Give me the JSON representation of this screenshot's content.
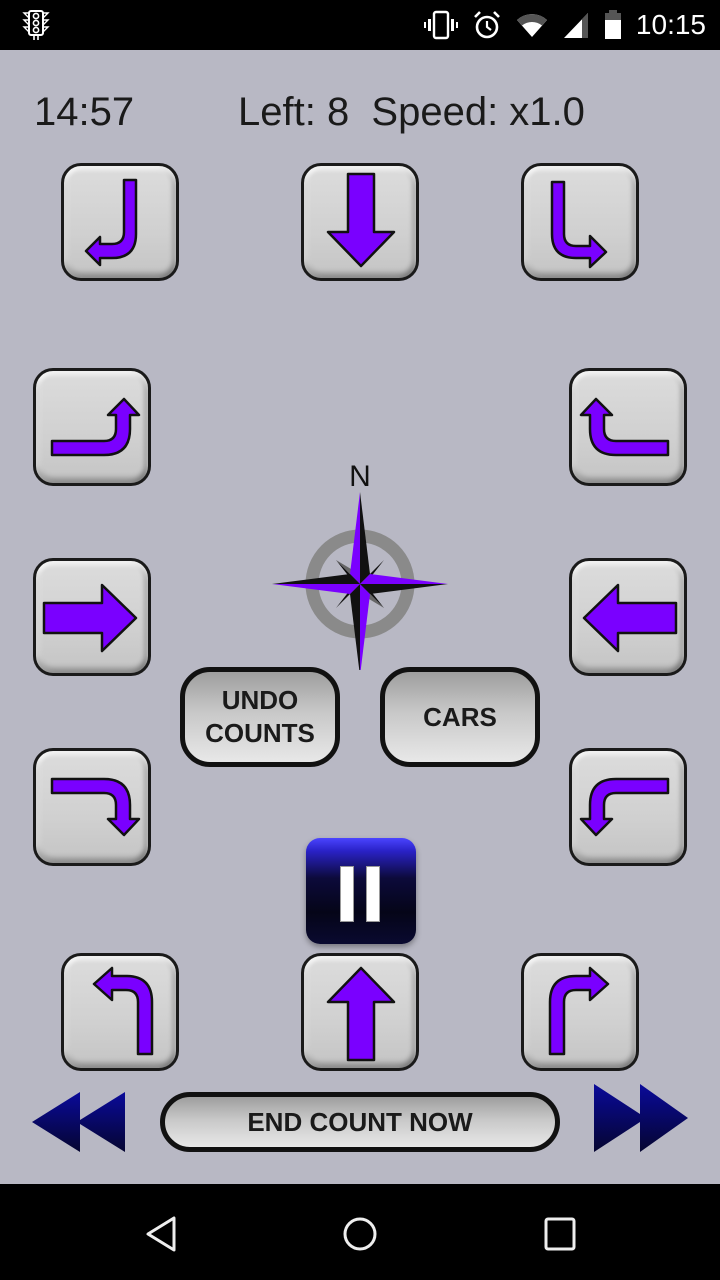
{
  "status_bar": {
    "app_icon": "traffic-light-icon",
    "icons": [
      "vibrate-icon",
      "alarm-icon",
      "wifi-icon",
      "signal-icon",
      "battery-icon"
    ],
    "time": "10:15"
  },
  "header": {
    "timer": "14:57",
    "left_label": "Left: 8  Speed: x1.0"
  },
  "movement_buttons": [
    {
      "id": "north-u-turn",
      "icon": "u-turn-left-down-icon"
    },
    {
      "id": "south-through",
      "icon": "arrow-down-icon"
    },
    {
      "id": "north-left",
      "icon": "turn-down-right-icon"
    },
    {
      "id": "west-u",
      "icon": "turn-right-up-icon"
    },
    {
      "id": "east-u",
      "icon": "turn-left-up-icon"
    },
    {
      "id": "west-through",
      "icon": "arrow-right-icon"
    },
    {
      "id": "east-through",
      "icon": "arrow-left-icon"
    },
    {
      "id": "west-right",
      "icon": "turn-right-down-icon"
    },
    {
      "id": "east-left",
      "icon": "turn-left-down-icon"
    },
    {
      "id": "south-left",
      "icon": "turn-up-left-icon"
    },
    {
      "id": "north-through",
      "icon": "arrow-up-icon"
    },
    {
      "id": "south-right",
      "icon": "turn-up-right-icon"
    }
  ],
  "compass": {
    "north_label": "N",
    "accent": "#7a00ff"
  },
  "buttons": {
    "undo_line1": "UNDO",
    "undo_line2": "COUNTS",
    "cars": "CARS",
    "end_count": "END COUNT NOW",
    "pause": "pause-icon",
    "rewind": "rewind-icon",
    "fast_forward": "fast-forward-icon"
  },
  "nav_bar": {
    "back": "back-icon",
    "home": "home-icon",
    "recents": "recents-icon"
  },
  "colors": {
    "background": "#b8b8c4",
    "arrow_fill": "#7a00ff",
    "navy": "#0a0a8a"
  }
}
